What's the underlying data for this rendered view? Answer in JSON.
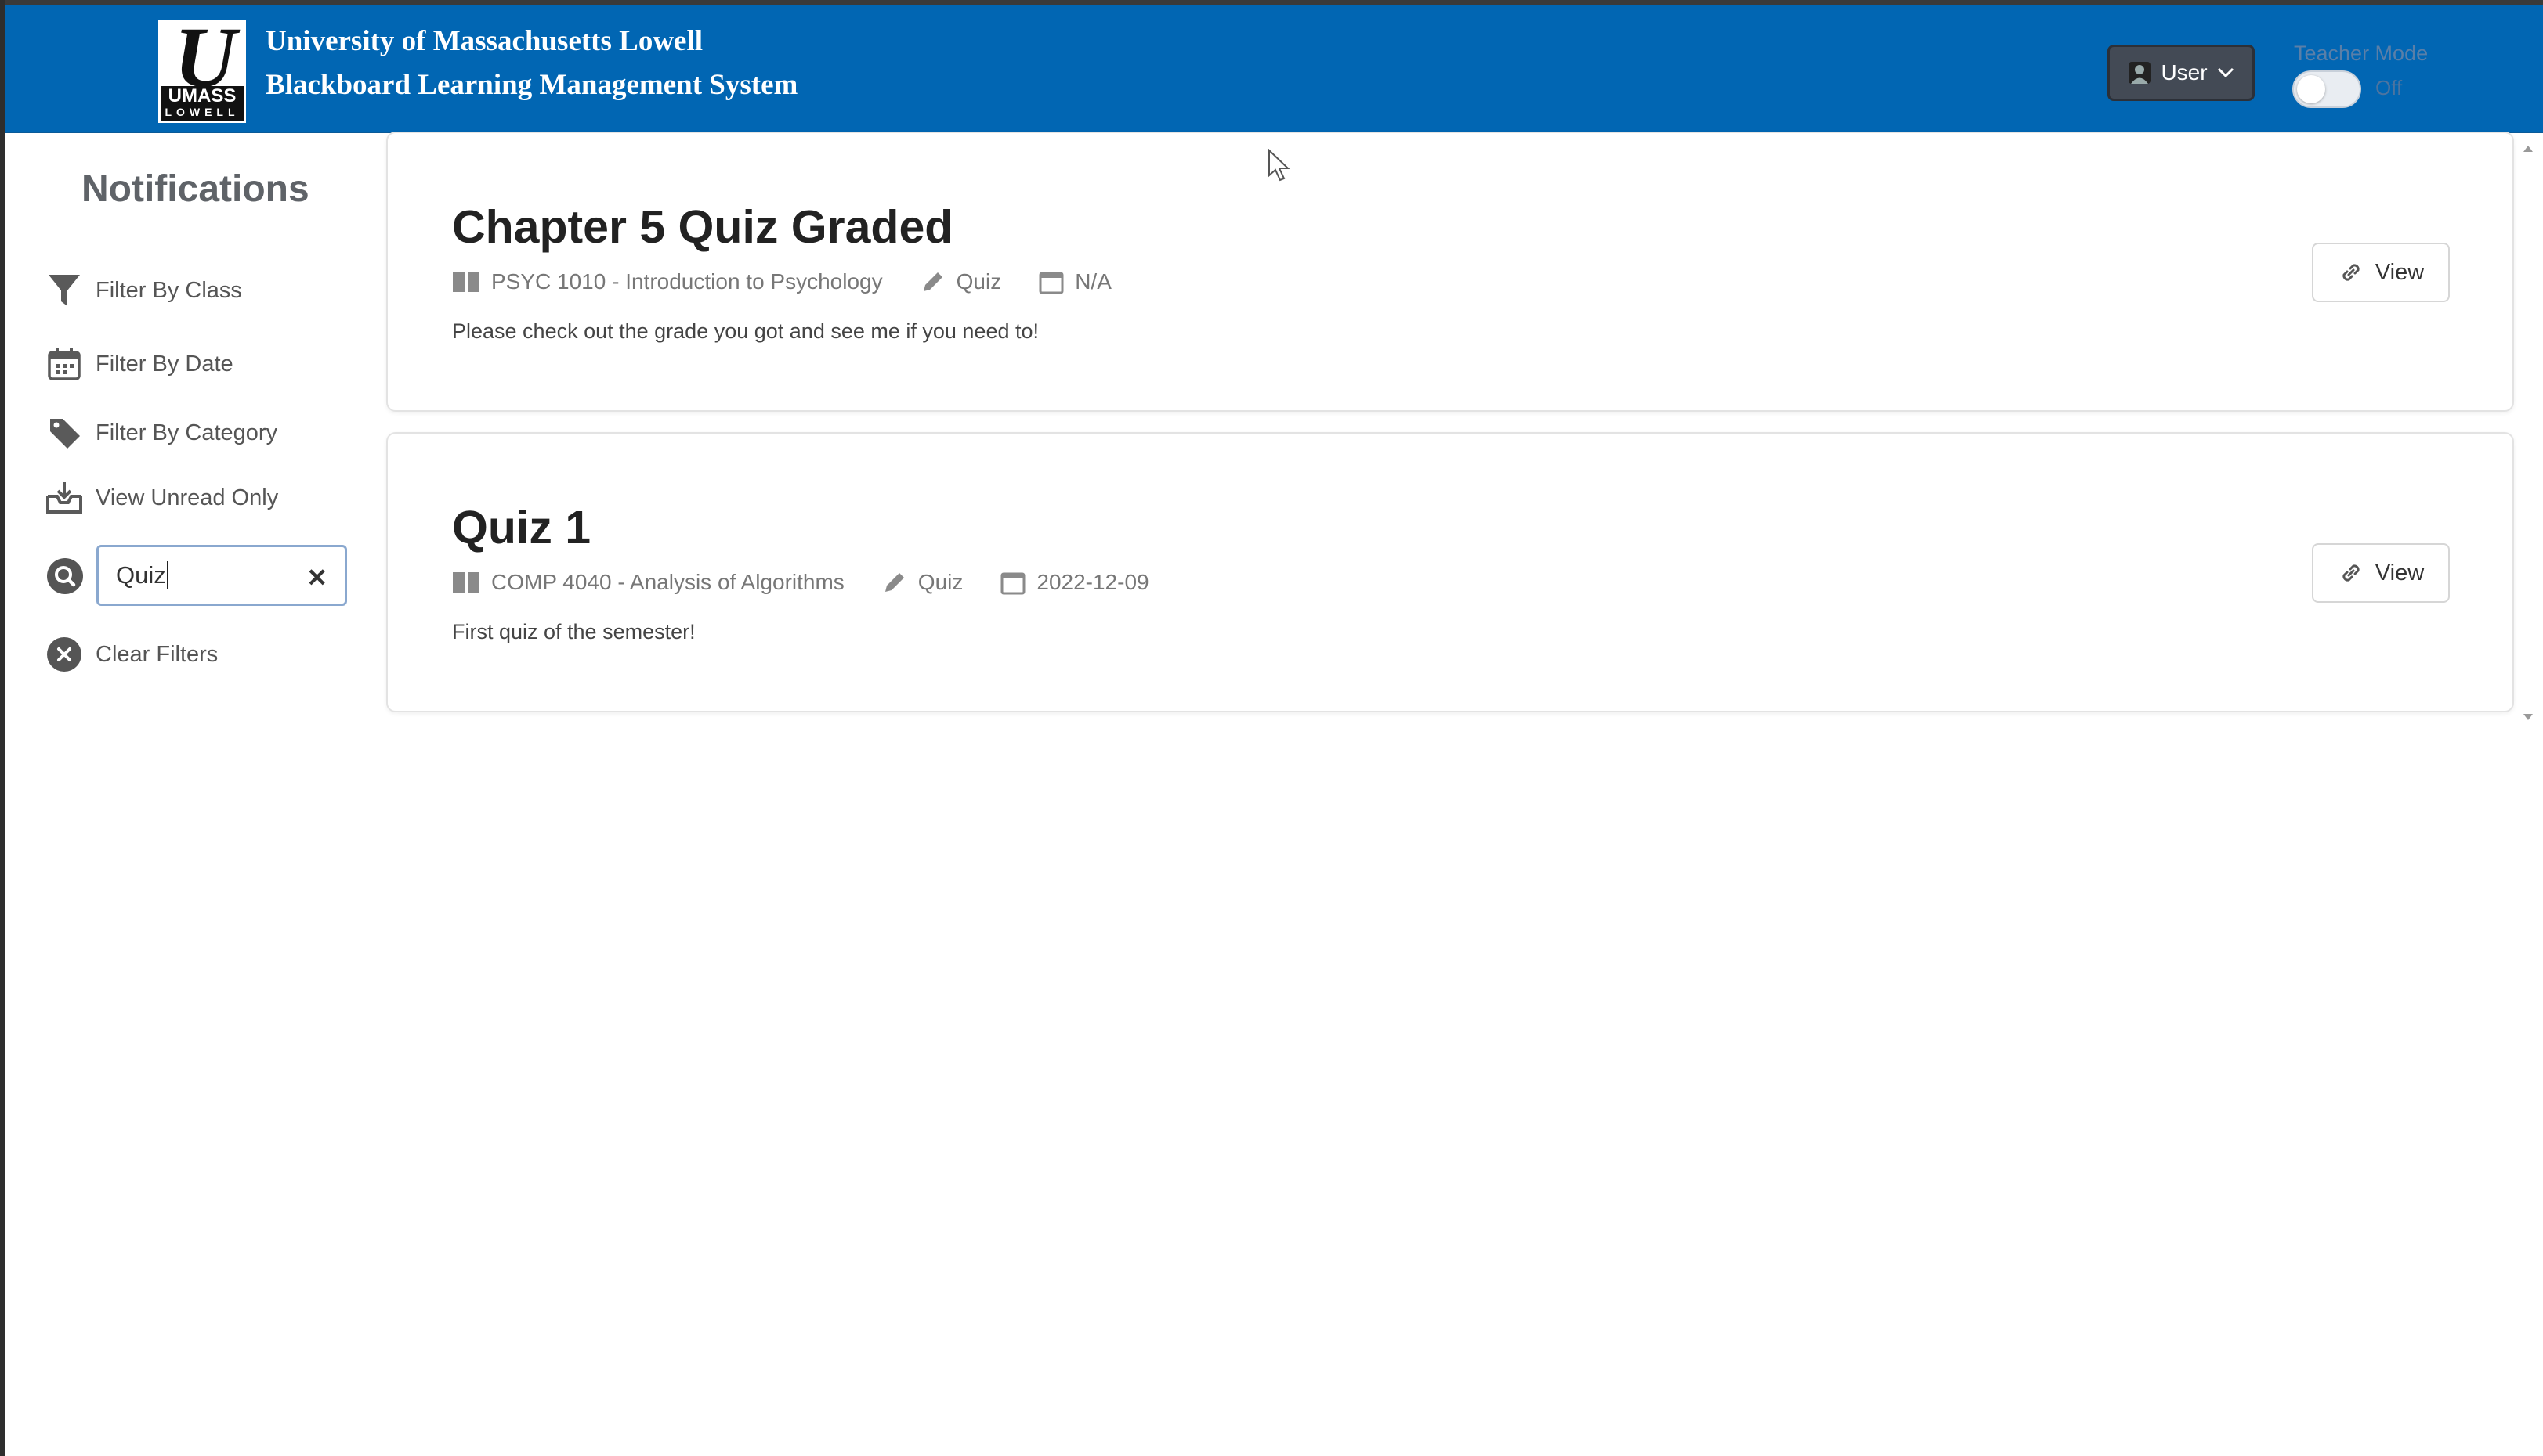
{
  "header": {
    "title_line1": "University of Massachusetts Lowell",
    "title_line2": "Blackboard Learning Management System",
    "logo_text": "UMASS",
    "logo_subtext": "LOWELL",
    "user_button_label": "User",
    "teacher_mode_label": "Teacher Mode",
    "teacher_mode_state": "Off",
    "brand_color": "#0166b3"
  },
  "sidebar": {
    "title": "Notifications",
    "filters": [
      {
        "label": "Filter By Class",
        "icon": "funnel-icon"
      },
      {
        "label": "Filter By Date",
        "icon": "calendar-icon"
      },
      {
        "label": "Filter By Category",
        "icon": "tag-icon"
      },
      {
        "label": "View Unread Only",
        "icon": "inbox-download-icon"
      }
    ],
    "search": {
      "value": "Quiz",
      "icon": "search-icon"
    },
    "clear_filters_label": "Clear Filters"
  },
  "notifications": [
    {
      "title": "Chapter 5 Quiz Graded",
      "course": "PSYC 1010 - Introduction to Psychology",
      "category": "Quiz",
      "date": "N/A",
      "description": "Please check out the grade you got and see me if you need to!",
      "view_label": "View"
    },
    {
      "title": "Quiz 1",
      "course": "COMP 4040 - Analysis of Algorithms",
      "category": "Quiz",
      "date": "2022-12-09",
      "description": "First quiz of the semester!",
      "view_label": "View"
    }
  ]
}
